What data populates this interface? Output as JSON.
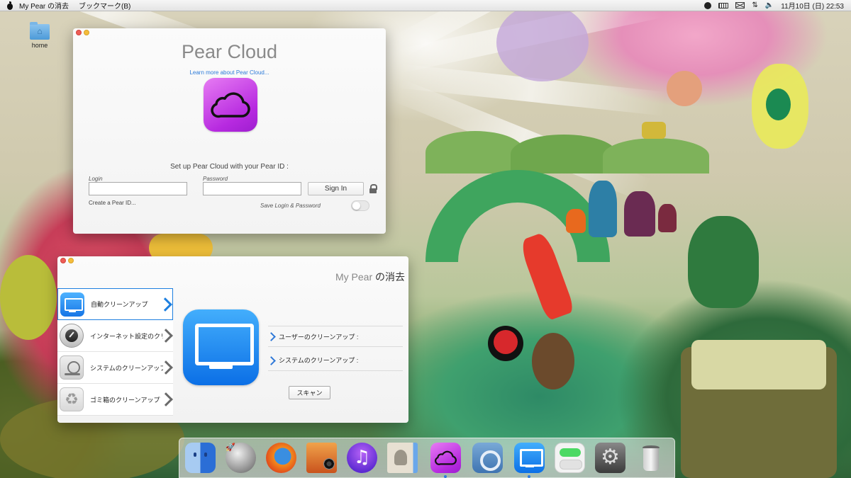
{
  "menubar": {
    "app_name": "My Pear の消去",
    "menu_bookmarks": "ブックマーク(B)",
    "clock": "11月10日 (日) 22:53",
    "status_icons": [
      "search-icon",
      "keyboard-icon",
      "mail-icon",
      "sync-icon",
      "volume-icon"
    ]
  },
  "desktop": {
    "icon_label": "home"
  },
  "cloud_window": {
    "title": "Pear Cloud",
    "learn_more": "Learn more about Pear Cloud...",
    "setup_text": "Set up Pear Cloud with your Pear ID :",
    "login_label": "Login",
    "login_value": "",
    "password_label": "Password",
    "password_value": "",
    "signin_label": "Sign In",
    "create_link": "Create a Pear ID...",
    "save_label": "Save Login & Password"
  },
  "cleanup_window": {
    "title_latin": "My Pear",
    "title_jp": "の消去",
    "sidebar": [
      {
        "label": "自動クリーンアップ",
        "icon": "monitor-icon"
      },
      {
        "label": "インターネット設定のクリーンアップ",
        "icon": "gauge-icon"
      },
      {
        "label": "システムのクリーンアップ",
        "icon": "vacuum-icon"
      },
      {
        "label": "ゴミ箱のクリーンアップ",
        "icon": "recycle-icon"
      }
    ],
    "options": [
      {
        "label": "ユーザーのクリーンアップ :"
      },
      {
        "label": "システムのクリーンアップ :"
      }
    ],
    "scan_label": "スキャン"
  },
  "dock": {
    "items": [
      "finder-icon",
      "launchpad-icon",
      "firefox-icon",
      "photo-booth-icon",
      "itunes-icon",
      "contacts-icon",
      "pear-cloud-icon",
      "cydia-icon",
      "my-pear-icon",
      "settings-icon",
      "system-preferences-icon",
      "trash-icon"
    ]
  }
}
